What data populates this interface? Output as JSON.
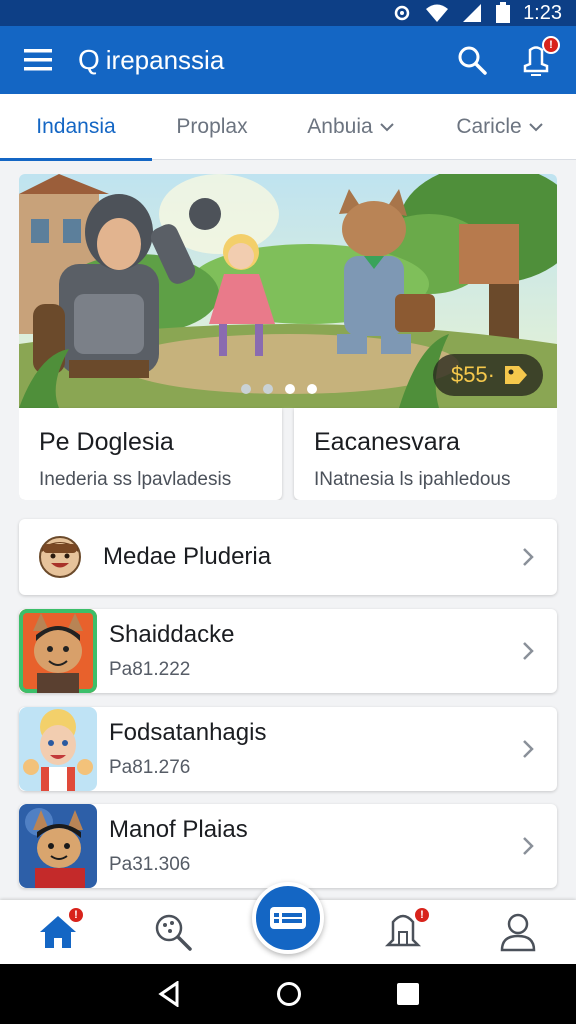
{
  "status": {
    "time": "1:23"
  },
  "appbar": {
    "title": "irepanssia",
    "search_glyph": "Q"
  },
  "tabs": [
    {
      "label": "Indansia",
      "active": true,
      "dropdown": false
    },
    {
      "label": "Proplax",
      "active": false,
      "dropdown": false
    },
    {
      "label": "Anbuia",
      "active": false,
      "dropdown": true
    },
    {
      "label": "Caricle",
      "active": false,
      "dropdown": true
    }
  ],
  "hero": {
    "price": "$55·",
    "dots_count": 4,
    "active_dot": 2,
    "left_card": {
      "title": "Pe Doglesia",
      "subtitle": "Inederia ss lpavladesis"
    },
    "right_card": {
      "title": "Eacanesvara",
      "subtitle": "INatnesia ls ipahledous"
    }
  },
  "featured": {
    "label": "Medae Pluderia"
  },
  "list": [
    {
      "name": "Shaiddacke",
      "meta": "Pa81.222"
    },
    {
      "name": "Fodsatanhagis",
      "meta": "Pa81.276"
    },
    {
      "name": "Manof Plaias",
      "meta": "Pa31.306"
    }
  ],
  "colors": {
    "primary": "#1466c4",
    "statusbar": "#0d3f86",
    "badge": "#d8231b"
  },
  "icons": [
    "menu-icon",
    "search-icon",
    "notification-icon",
    "home-icon",
    "discover-icon",
    "ticket-icon",
    "bell-icon",
    "profile-icon"
  ]
}
